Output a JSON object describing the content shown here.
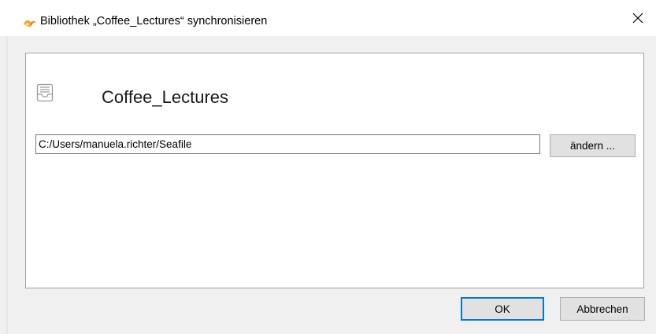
{
  "window": {
    "title": "Bibliothek „Coffee_Lectures“ synchronisieren",
    "app_icon": "seafile-icon",
    "close_icon": "close-icon",
    "accent_color": "#0078d7",
    "app_icon_color": "#f5a023"
  },
  "library": {
    "icon": "library-tray-icon",
    "name": "Coffee_Lectures"
  },
  "path": {
    "value": "C:/Users/manuela.richter/Seafile",
    "change_label": "ändern ..."
  },
  "footer": {
    "ok_label": "OK",
    "cancel_label": "Abbrechen"
  }
}
